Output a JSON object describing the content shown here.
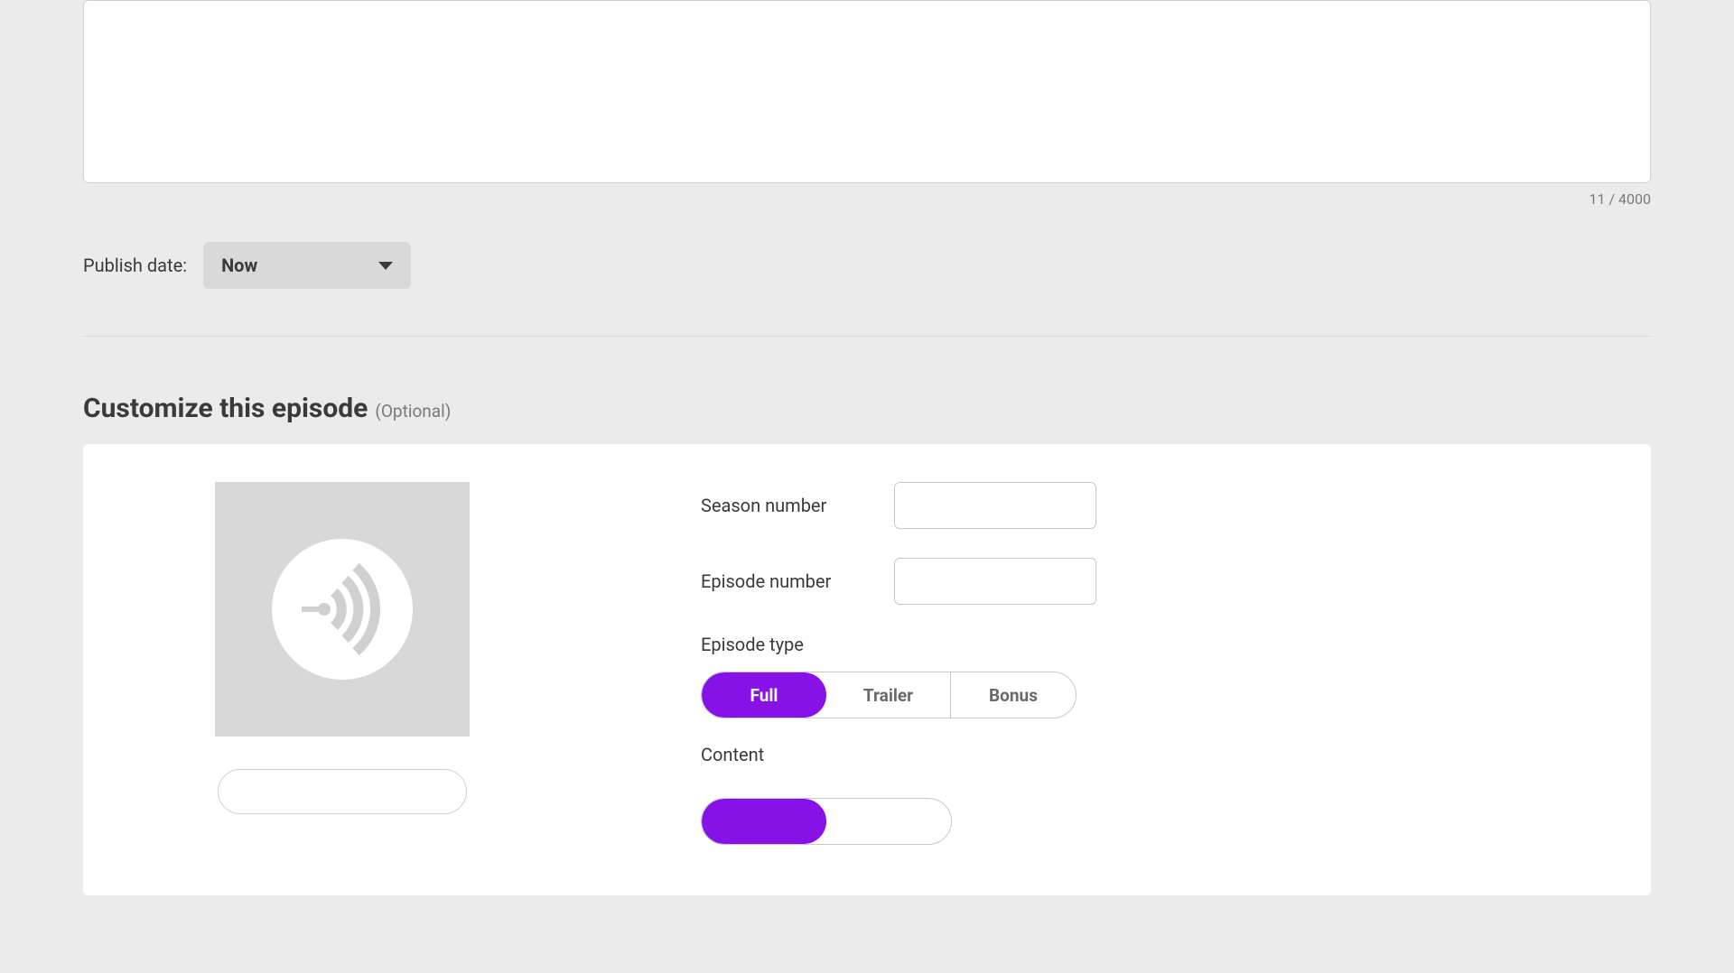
{
  "description": {
    "value": "",
    "counter": "11 / 4000"
  },
  "publish": {
    "label": "Publish date:",
    "selected": "Now"
  },
  "customize": {
    "title": "Customize this episode",
    "optional": "(Optional)",
    "season_label": "Season number",
    "season_value": "",
    "episode_label": "Episode number",
    "episode_value": "",
    "type_label": "Episode type",
    "type_options": {
      "full": "Full",
      "trailer": "Trailer",
      "bonus": "Bonus"
    },
    "content_label": "Content"
  }
}
